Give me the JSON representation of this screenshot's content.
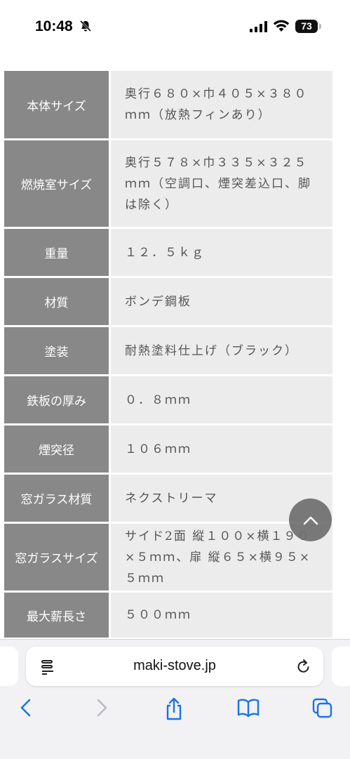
{
  "status_bar": {
    "time": "10:48",
    "battery": "73"
  },
  "specs": [
    {
      "label": "本体サイズ",
      "value": "奥行６８０×巾４０５×３８０ｍｍ（放熱フィンあり）"
    },
    {
      "label": "燃焼室サイズ",
      "value": "奥行５７８×巾３３５×３２５ｍｍ（空調口、煙突差込口、脚は除く）"
    },
    {
      "label": "重量",
      "value": "１２．５ｋｇ"
    },
    {
      "label": "材質",
      "value": "ボンデ鋼板"
    },
    {
      "label": "塗装",
      "value": "耐熱塗料仕上げ（ブラック）"
    },
    {
      "label": "鉄板の厚み",
      "value": "０．８ｍｍ"
    },
    {
      "label": "煙突径",
      "value": "１０６ｍｍ"
    },
    {
      "label": "窓ガラス材質",
      "value": "ネクストリーマ"
    },
    {
      "label": "窓ガラスサイズ",
      "value": "サイド2面 縦１００×横１９０×５ｍｍ、扉 縦６５×横９５×５ｍｍ"
    },
    {
      "label": "最大薪長さ",
      "value": "５００ｍｍ"
    }
  ],
  "browser": {
    "url": "maki-stove.jp"
  },
  "icons": {
    "bell": "bell-slash-icon",
    "signal": "signal-icon",
    "wifi": "wifi-icon",
    "scroll_top": "chevron-up-icon",
    "reader": "reader-icon",
    "reload": "reload-icon",
    "back": "back-icon",
    "forward": "forward-icon",
    "share": "share-icon",
    "bookmarks": "bookmarks-icon",
    "tabs": "tabs-icon"
  },
  "colors": {
    "label_bg": "#888888",
    "value_bg": "#ececec",
    "accent": "#1a73e8"
  }
}
